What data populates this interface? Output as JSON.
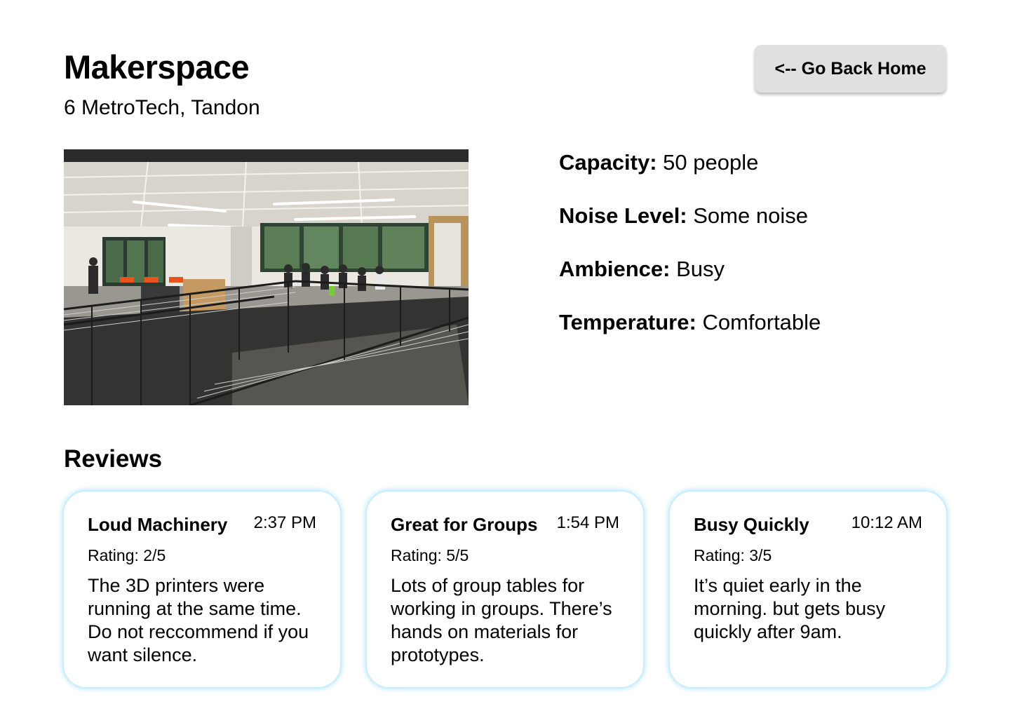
{
  "header": {
    "title": "Makerspace",
    "location": "6 MetroTech, Tandon",
    "back_button_label": "<-- Go Back Home"
  },
  "photo": {
    "description_icon": "makerspace-photo"
  },
  "details": [
    {
      "key": "Capacity:",
      "value": "50 people"
    },
    {
      "key": "Noise Level:",
      "value": "Some noise"
    },
    {
      "key": "Ambience:",
      "value": "Busy"
    },
    {
      "key": "Temperature:",
      "value": "Comfortable"
    }
  ],
  "reviews": {
    "heading": "Reviews",
    "items": [
      {
        "title": "Loud Machinery",
        "time": "2:37 PM",
        "rating": "Rating: 2/5",
        "body": "The 3D printers were running at the same time. Do not reccommend if you want silence."
      },
      {
        "title": "Great for Groups",
        "time": "1:54 PM",
        "rating": "Rating: 5/5",
        "body": "Lots of group tables for working in groups. There’s hands on materials for prototypes."
      },
      {
        "title": "Busy Quickly",
        "time": "10:12 AM",
        "rating": "Rating: 3/5",
        "body": "It’s quiet early in the morning. but gets busy quickly after 9am."
      }
    ]
  },
  "colors": {
    "card_border": "#cbeefb",
    "button_bg": "#e0e0e0",
    "accent_orange": "#e8541c"
  }
}
